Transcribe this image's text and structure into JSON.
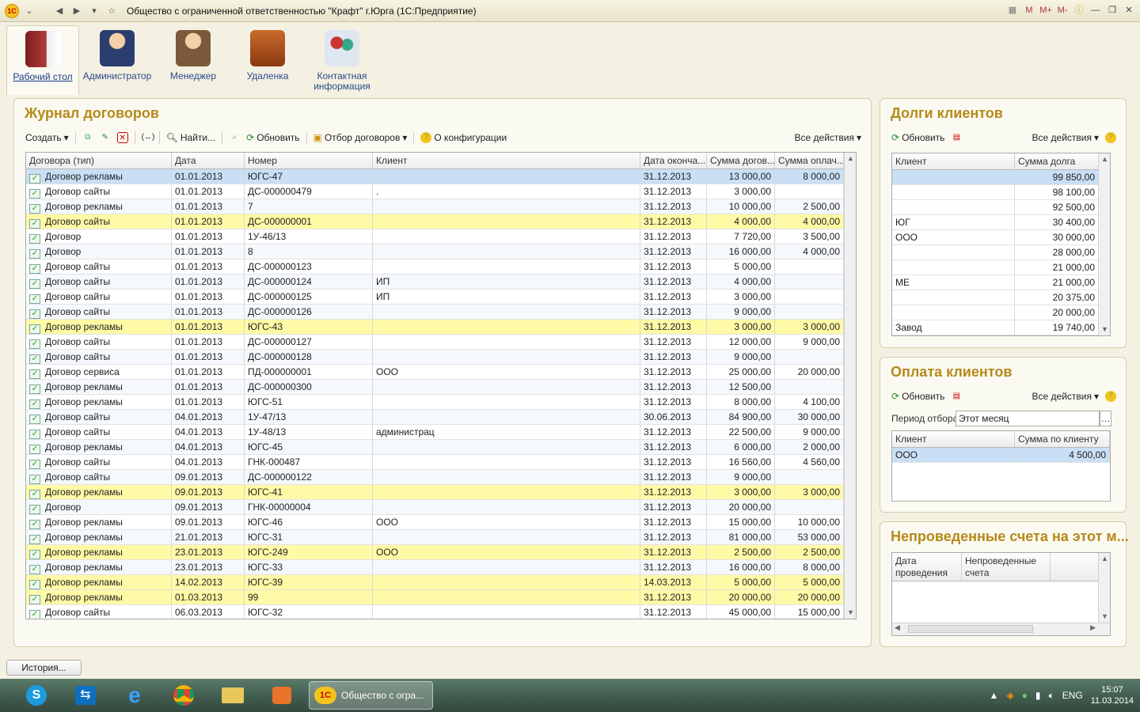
{
  "window": {
    "title": "Общество с ограниченной ответственностью \"Крафт\" г.Юрга  (1С:Предприятие)",
    "logo": "1С",
    "right_buttons": [
      "M",
      "M+",
      "M-"
    ]
  },
  "sections": [
    {
      "label": "Рабочий стол",
      "active": true
    },
    {
      "label": "Администратор"
    },
    {
      "label": "Менеджер"
    },
    {
      "label": "Удаленка"
    },
    {
      "label": "Контактная информация"
    }
  ],
  "journal": {
    "title": "Журнал договоров",
    "toolbar": {
      "create": "Создать",
      "find": "Найти...",
      "refresh": "Обновить",
      "filter": "Отбор договоров",
      "about": "О конфигурации",
      "all_actions": "Все действия"
    },
    "columns": [
      "Договора (тип)",
      "Дата",
      "Номер",
      "Клиент",
      "Дата оконча...",
      "Сумма догов...",
      "Сумма оплач..."
    ],
    "rows": [
      {
        "t": "Договор рекламы",
        "d": "01.01.2013",
        "n": "ЮГС-47",
        "c": "",
        "e": "31.12.2013",
        "s": "13 000,00",
        "p": "8 000,00",
        "k": "sel"
      },
      {
        "t": "Договор сайты",
        "d": "01.01.2013",
        "n": "ДС-000000479",
        "c": ".",
        "e": "31.12.2013",
        "s": "3 000,00",
        "p": "",
        "k": ""
      },
      {
        "t": "Договор рекламы",
        "d": "01.01.2013",
        "n": "7",
        "c": "",
        "e": "31.12.2013",
        "s": "10 000,00",
        "p": "2 500,00",
        "k": "alt"
      },
      {
        "t": "Договор сайты",
        "d": "01.01.2013",
        "n": "ДС-000000001",
        "c": "",
        "e": "31.12.2013",
        "s": "4 000,00",
        "p": "4 000,00",
        "k": "yel"
      },
      {
        "t": "Договор",
        "d": "01.01.2013",
        "n": "1У-46/13",
        "c": "",
        "e": "31.12.2013",
        "s": "7 720,00",
        "p": "3 500,00",
        "k": ""
      },
      {
        "t": "Договор",
        "d": "01.01.2013",
        "n": "8",
        "c": "",
        "e": "31.12.2013",
        "s": "16 000,00",
        "p": "4 000,00",
        "k": "alt"
      },
      {
        "t": "Договор сайты",
        "d": "01.01.2013",
        "n": "ДС-000000123",
        "c": "",
        "e": "31.12.2013",
        "s": "5 000,00",
        "p": "",
        "k": ""
      },
      {
        "t": "Договор сайты",
        "d": "01.01.2013",
        "n": "ДС-000000124",
        "c": "ИП",
        "e": "31.12.2013",
        "s": "4 000,00",
        "p": "",
        "k": "alt"
      },
      {
        "t": "Договор сайты",
        "d": "01.01.2013",
        "n": "ДС-000000125",
        "c": "ИП",
        "e": "31.12.2013",
        "s": "3 000,00",
        "p": "",
        "k": ""
      },
      {
        "t": "Договор сайты",
        "d": "01.01.2013",
        "n": "ДС-000000126",
        "c": "",
        "e": "31.12.2013",
        "s": "9 000,00",
        "p": "",
        "k": "alt"
      },
      {
        "t": "Договор рекламы",
        "d": "01.01.2013",
        "n": "ЮГС-43",
        "c": "",
        "e": "31.12.2013",
        "s": "3 000,00",
        "p": "3 000,00",
        "k": "yel"
      },
      {
        "t": "Договор сайты",
        "d": "01.01.2013",
        "n": "ДС-000000127",
        "c": "",
        "e": "31.12.2013",
        "s": "12 000,00",
        "p": "9 000,00",
        "k": ""
      },
      {
        "t": "Договор сайты",
        "d": "01.01.2013",
        "n": "ДС-000000128",
        "c": "",
        "e": "31.12.2013",
        "s": "9 000,00",
        "p": "",
        "k": "alt"
      },
      {
        "t": "Договор сервиса",
        "d": "01.01.2013",
        "n": "ПД-000000001",
        "c": "ООО",
        "e": "31.12.2013",
        "s": "25 000,00",
        "p": "20 000,00",
        "k": ""
      },
      {
        "t": "Договор рекламы",
        "d": "01.01.2013",
        "n": "ДС-000000300",
        "c": "",
        "e": "31.12.2013",
        "s": "12 500,00",
        "p": "",
        "k": "alt"
      },
      {
        "t": "Договор рекламы",
        "d": "01.01.2013",
        "n": "ЮГС-51",
        "c": "",
        "e": "31.12.2013",
        "s": "8 000,00",
        "p": "4 100,00",
        "k": ""
      },
      {
        "t": "Договор сайты",
        "d": "04.01.2013",
        "n": "1У-47/13",
        "c": "",
        "e": "30.06.2013",
        "s": "84 900,00",
        "p": "30 000,00",
        "k": "alt"
      },
      {
        "t": "Договор сайты",
        "d": "04.01.2013",
        "n": "1У-48/13",
        "c": "администрац",
        "e": "31.12.2013",
        "s": "22 500,00",
        "p": "9 000,00",
        "k": ""
      },
      {
        "t": "Договор рекламы",
        "d": "04.01.2013",
        "n": "ЮГС-45",
        "c": "",
        "e": "31.12.2013",
        "s": "6 000,00",
        "p": "2 000,00",
        "k": "alt"
      },
      {
        "t": "Договор сайты",
        "d": "04.01.2013",
        "n": "ГНК-000487",
        "c": "",
        "e": "31.12.2013",
        "s": "16 560,00",
        "p": "4 560,00",
        "k": ""
      },
      {
        "t": "Договор сайты",
        "d": "09.01.2013",
        "n": "ДС-000000122",
        "c": "",
        "e": "31.12.2013",
        "s": "9 000,00",
        "p": "",
        "k": "alt"
      },
      {
        "t": "Договор рекламы",
        "d": "09.01.2013",
        "n": "ЮГС-41",
        "c": "",
        "e": "31.12.2013",
        "s": "3 000,00",
        "p": "3 000,00",
        "k": "yel"
      },
      {
        "t": "Договор",
        "d": "09.01.2013",
        "n": "ГНК-00000004",
        "c": "",
        "e": "31.12.2013",
        "s": "20 000,00",
        "p": "",
        "k": "alt"
      },
      {
        "t": "Договор рекламы",
        "d": "09.01.2013",
        "n": "ЮГС-46",
        "c": "ООО",
        "e": "31.12.2013",
        "s": "15 000,00",
        "p": "10 000,00",
        "k": ""
      },
      {
        "t": "Договор рекламы",
        "d": "21.01.2013",
        "n": "ЮГС-31",
        "c": "",
        "e": "31.12.2013",
        "s": "81 000,00",
        "p": "53 000,00",
        "k": "alt"
      },
      {
        "t": "Договор рекламы",
        "d": "23.01.2013",
        "n": "ЮГС-249",
        "c": "ООО",
        "e": "31.12.2013",
        "s": "2 500,00",
        "p": "2 500,00",
        "k": "yel"
      },
      {
        "t": "Договор рекламы",
        "d": "23.01.2013",
        "n": "ЮГС-33",
        "c": "",
        "e": "31.12.2013",
        "s": "16 000,00",
        "p": "8 000,00",
        "k": "alt"
      },
      {
        "t": "Договор рекламы",
        "d": "14.02.2013",
        "n": "ЮГС-39",
        "c": "",
        "e": "14.03.2013",
        "s": "5 000,00",
        "p": "5 000,00",
        "k": "yel"
      },
      {
        "t": "Договор рекламы",
        "d": "01.03.2013",
        "n": "99",
        "c": "",
        "e": "31.12.2013",
        "s": "20 000,00",
        "p": "20 000,00",
        "k": "yel"
      },
      {
        "t": "Договор сайты",
        "d": "06.03.2013",
        "n": "ЮГС-32",
        "c": "",
        "e": "31.12.2013",
        "s": "45 000,00",
        "p": "15 000,00",
        "k": ""
      }
    ]
  },
  "debts": {
    "title": "Долги клиентов",
    "refresh": "Обновить",
    "all_actions": "Все действия",
    "columns": [
      "Клиент",
      "Сумма долга"
    ],
    "rows": [
      {
        "c": "",
        "v": "99 850,00"
      },
      {
        "c": "",
        "v": "98 100,00"
      },
      {
        "c": "",
        "v": "92 500,00"
      },
      {
        "c": "ЮГ",
        "v": "30 400,00"
      },
      {
        "c": "ООО",
        "v": "30 000,00"
      },
      {
        "c": "",
        "v": "28 000,00"
      },
      {
        "c": "",
        "v": "21 000,00"
      },
      {
        "c": "МЕ",
        "v": "21 000,00"
      },
      {
        "c": "",
        "v": "20 375,00"
      },
      {
        "c": "",
        "v": "20 000,00"
      },
      {
        "c": "Завод",
        "v": "19 740,00"
      }
    ]
  },
  "payments": {
    "title": "Оплата клиентов",
    "refresh": "Обновить",
    "all_actions": "Все действия",
    "period_label": "Период отбора:",
    "period_value": "Этот месяц",
    "columns": [
      "Клиент",
      "Сумма по клиенту"
    ],
    "rows": [
      {
        "c": "ООО",
        "v": "4 500,00"
      }
    ]
  },
  "invoices": {
    "title": "Непроведенные счета на этот м...",
    "columns": [
      "Дата проведения",
      "Непроведенные счета"
    ]
  },
  "status": {
    "history": "История..."
  },
  "taskbar": {
    "active_window": "Общество с огра...",
    "lang": "ENG",
    "time": "15:07",
    "date": "11.03.2014"
  }
}
